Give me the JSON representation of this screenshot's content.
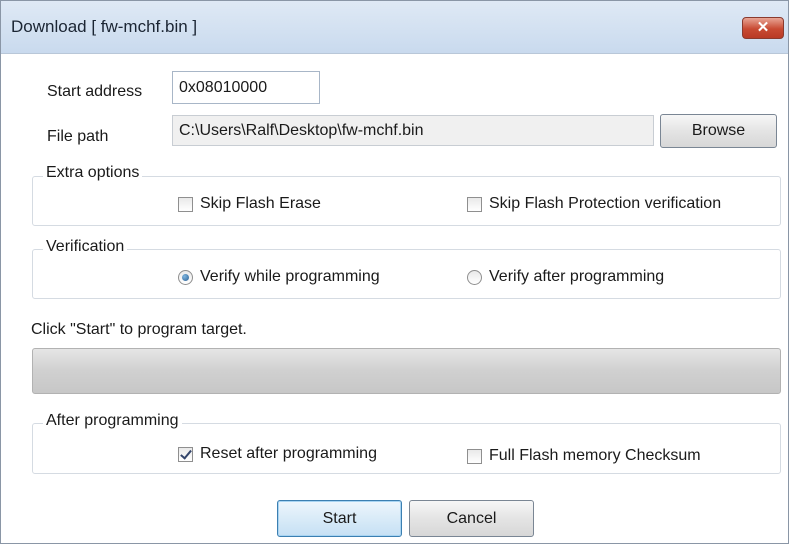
{
  "window": {
    "title": "Download [ fw-mchf.bin ]",
    "close_glyph": "✕"
  },
  "form": {
    "start_address_label": "Start address",
    "start_address_value": "0x08010000",
    "file_path_label": "File path",
    "file_path_value": "C:\\Users\\Ralf\\Desktop\\fw-mchf.bin",
    "browse_label": "Browse"
  },
  "extra_options": {
    "title": "Extra options",
    "skip_flash_erase": {
      "label": "Skip Flash Erase",
      "checked": false
    },
    "skip_protection_verification": {
      "label": "Skip Flash Protection verification",
      "checked": false
    }
  },
  "verification": {
    "title": "Verification",
    "verify_while": {
      "label": "Verify while programming",
      "selected": true
    },
    "verify_after": {
      "label": "Verify after programming",
      "selected": false
    }
  },
  "status": {
    "message": "Click \"Start\" to program target.",
    "progress": 0
  },
  "after_programming": {
    "title": "After programming",
    "reset_after": {
      "label": "Reset after programming",
      "checked": true
    },
    "full_checksum": {
      "label": "Full Flash memory Checksum",
      "checked": false
    }
  },
  "actions": {
    "start_label": "Start",
    "cancel_label": "Cancel"
  },
  "colors": {
    "title_bar": "#c9daee",
    "close_button": "#c84a33",
    "window_bg": "#ffffff"
  }
}
